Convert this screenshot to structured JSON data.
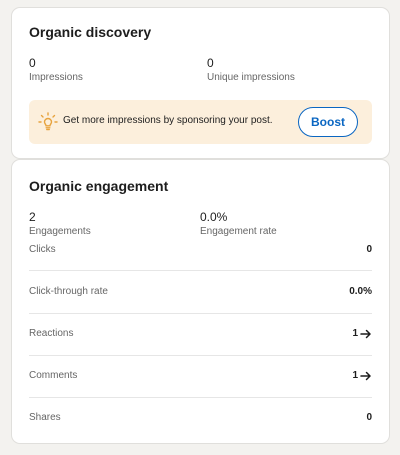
{
  "organic_discovery": {
    "title": "Organic discovery",
    "impressions_value": "0",
    "impressions_label": "Impressions",
    "unique_impressions_value": "0",
    "unique_impressions_label": "Unique impressions",
    "boost_prompt": "Get more impressions by sponsoring your post.",
    "boost_label": "Boost",
    "bulb_icon": "lightbulb-icon"
  },
  "organic_engagement": {
    "title": "Organic engagement",
    "engagements_value": "2",
    "engagements_label": "Engagements",
    "engagement_rate_value": "0.0%",
    "engagement_rate_label": "Engagement rate",
    "rows": [
      {
        "label": "Clicks",
        "value": "0",
        "arrow": false
      },
      {
        "label": "Click-through rate",
        "value": "0.0%",
        "arrow": false
      },
      {
        "label": "Reactions",
        "value": "1",
        "arrow": true
      },
      {
        "label": "Comments",
        "value": "1",
        "arrow": true
      },
      {
        "label": "Shares",
        "value": "0",
        "arrow": false
      }
    ]
  },
  "colors": {
    "accent": "#0a66c2",
    "boost_bg": "#fcefdc",
    "bulb": "#e7a33e"
  }
}
